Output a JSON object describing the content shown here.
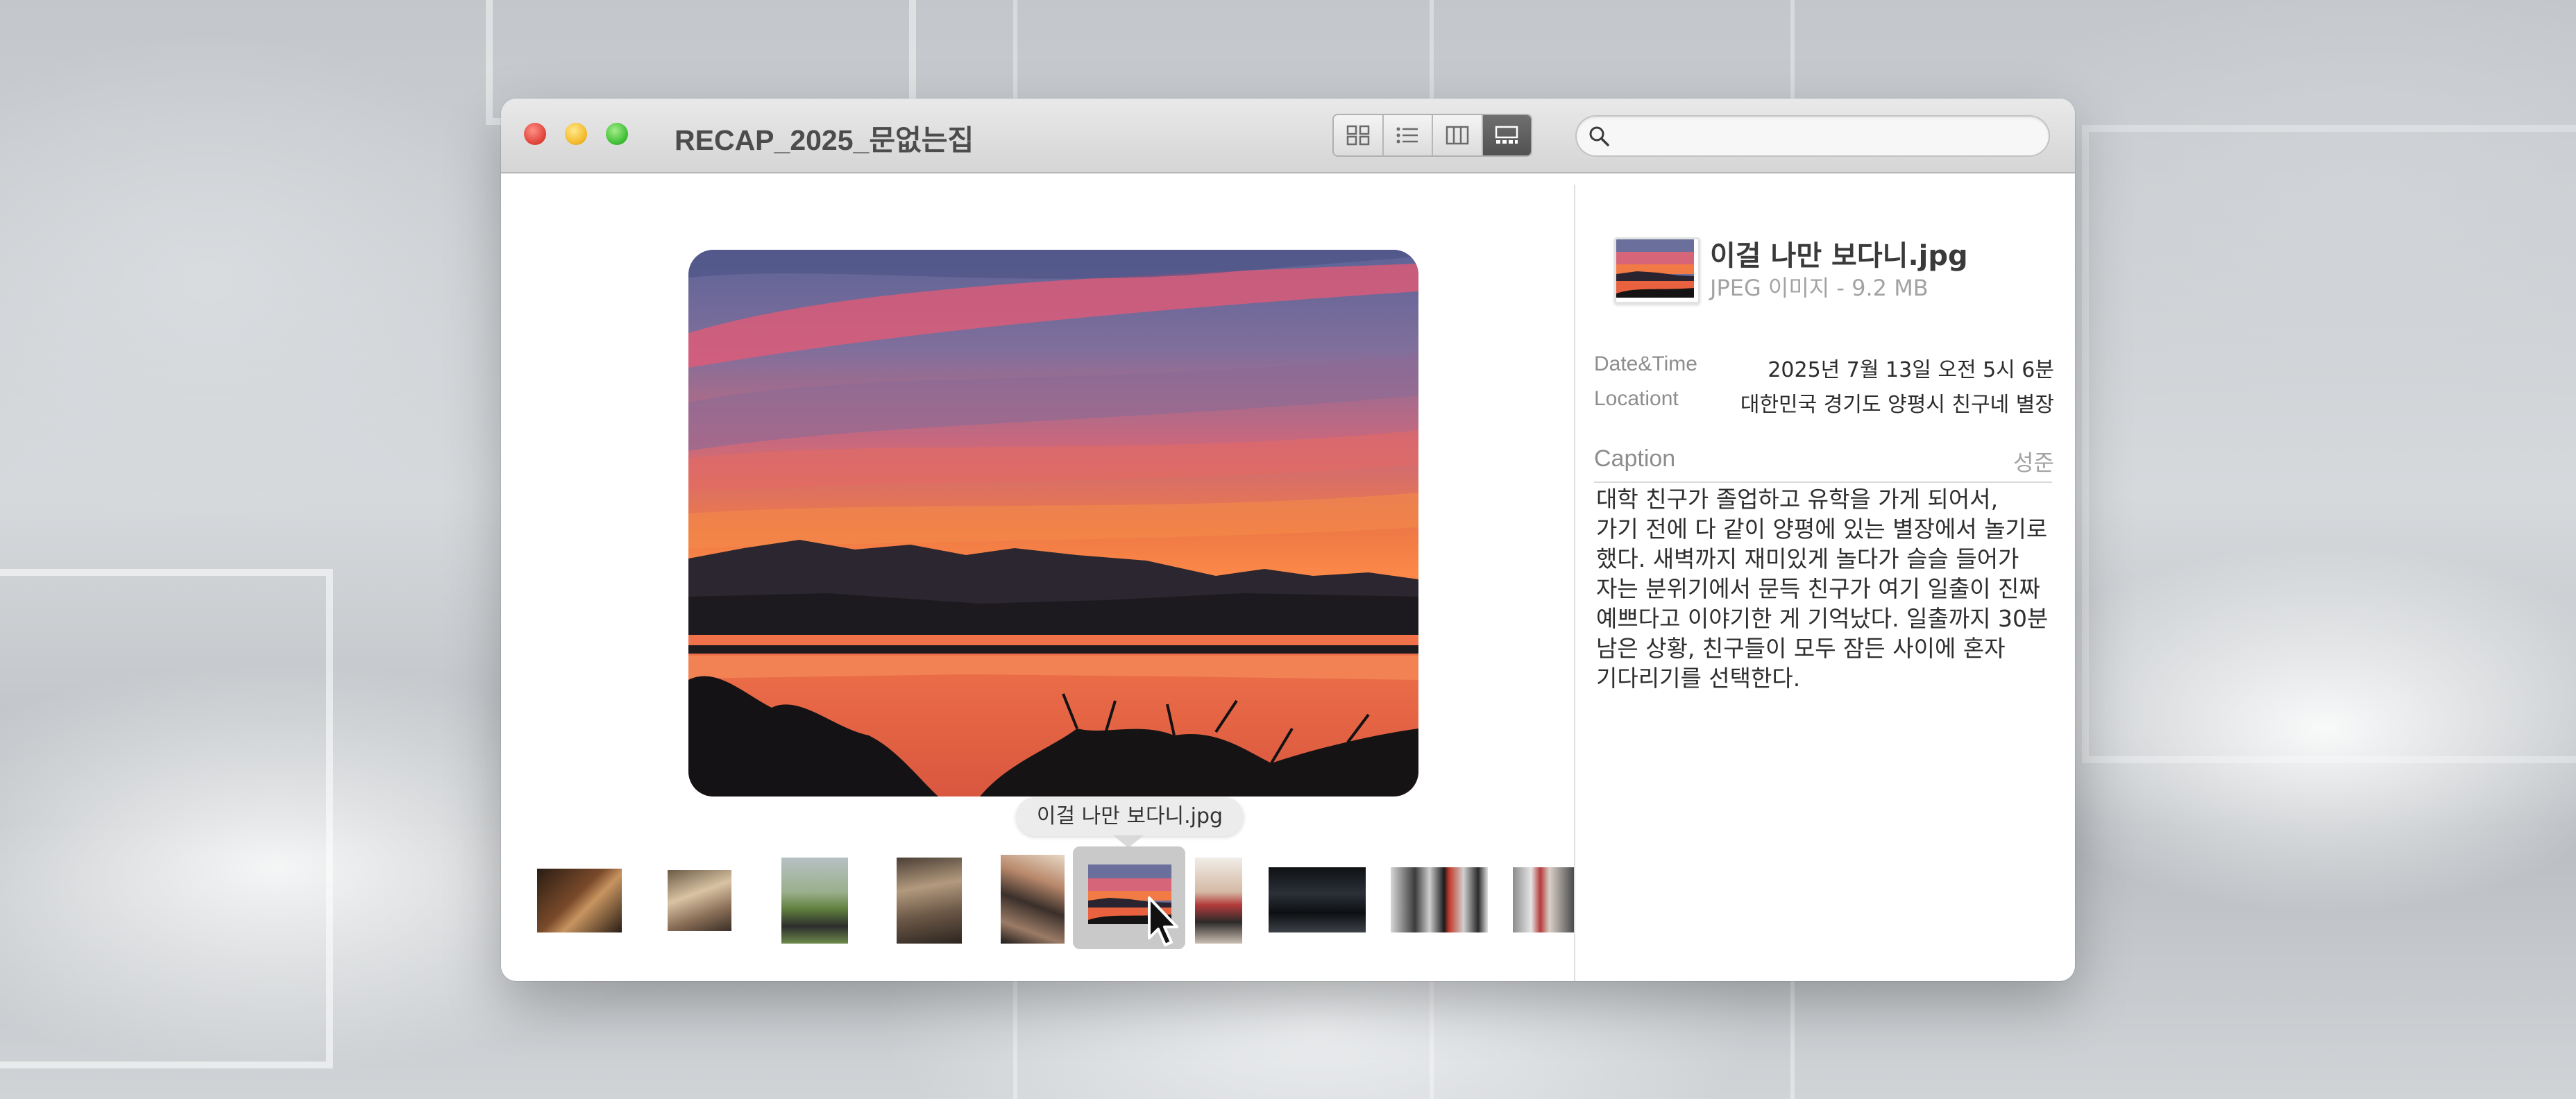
{
  "window": {
    "title": "RECAP_2025_문없는집",
    "view_modes": [
      "icon-view",
      "list-view",
      "column-view",
      "gallery-view"
    ],
    "active_view": "gallery-view",
    "search": {
      "value": "",
      "placeholder": ""
    }
  },
  "preview": {
    "selected_file": "이걸 나만 보다니.jpg",
    "tooltip": "이걸 나만 보다니.jpg",
    "thumbnail_count": 10,
    "selected_index": 5
  },
  "sidebar": {
    "file_name": "이걸 나만 보다니.jpg",
    "file_meta": "JPEG 이미지 - 9.2 MB",
    "rows": [
      {
        "label": "Date&Time",
        "value": "2025년 7월 13일 오전 5시 6분"
      },
      {
        "label": "Locationt",
        "value": "대한민국 경기도 양평시 친구네 별장"
      }
    ],
    "caption_label": "Caption",
    "caption_author": "성준",
    "caption_text": "대학 친구가 졸업하고 유학을 가게 되어서,\n가기 전에 다 같이 양평에 있는 별장에서 놀기로\n했다. 새벽까지 재미있게 놀다가 슬슬 들어가\n자는 분위기에서 문득 친구가 여기 일출이 진짜\n예쁘다고 이야기한 게 기억났다. 일출까지 30분\n남은 상황, 친구들이 모두 잠든 사이에 혼자\n기다리기를 선택한다."
  },
  "colors": {
    "sunset_sky_top": "#6b6f9a",
    "sunset_orange": "#f2703a",
    "sunset_pink": "#e05a78",
    "titlebar": "#dcdcdc"
  }
}
